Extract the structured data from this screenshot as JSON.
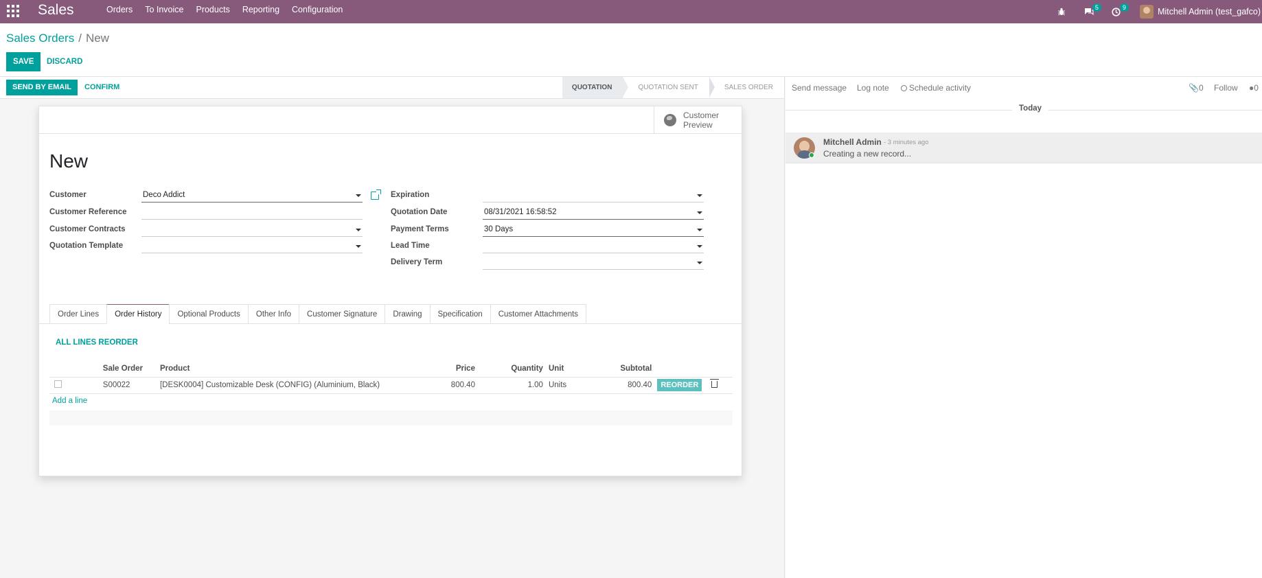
{
  "navbar": {
    "app_title": "Sales",
    "menu": [
      "Orders",
      "To Invoice",
      "Products",
      "Reporting",
      "Configuration"
    ],
    "messages_badge": "5",
    "activities_badge": "9",
    "user_name": "Mitchell Admin (test_gafco)"
  },
  "breadcrumb": {
    "parent": "Sales Orders",
    "separator": "/",
    "current": "New"
  },
  "actions": {
    "save": "SAVE",
    "discard": "DISCARD"
  },
  "statusbar": {
    "send_email": "SEND BY EMAIL",
    "confirm": "CONFIRM",
    "stages": [
      "QUOTATION",
      "QUOTATION SENT",
      "SALES ORDER"
    ],
    "active_stage": "QUOTATION"
  },
  "smart_button": {
    "label": "Customer Preview"
  },
  "form": {
    "title": "New",
    "left_fields": [
      {
        "label": "Customer",
        "value": "Deco Addict"
      },
      {
        "label": "Customer Reference",
        "value": ""
      },
      {
        "label": "Customer Contracts",
        "value": ""
      },
      {
        "label": "Quotation Template",
        "value": ""
      }
    ],
    "right_fields": [
      {
        "label": "Expiration",
        "value": ""
      },
      {
        "label": "Quotation Date",
        "value": "08/31/2021 16:58:52"
      },
      {
        "label": "Payment Terms",
        "value": "30 Days"
      },
      {
        "label": "Lead Time",
        "value": ""
      },
      {
        "label": "Delivery Term",
        "value": ""
      }
    ]
  },
  "tabs": [
    "Order Lines",
    "Order History",
    "Optional Products",
    "Other Info",
    "Customer Signature",
    "Drawing",
    "Specification",
    "Customer Attachments"
  ],
  "active_tab": "Order History",
  "history": {
    "reorder_all": "ALL LINES REORDER",
    "columns": [
      "Sale Order",
      "Product",
      "Price",
      "Quantity",
      "Unit",
      "Subtotal"
    ],
    "rows": [
      {
        "sale_order": "S00022",
        "product": "[DESK0004] Customizable Desk (CONFIG) (Aluminium, Black)",
        "price": "800.40",
        "quantity": "1.00",
        "unit": "Units",
        "subtotal": "800.40",
        "action": "REORDER"
      }
    ],
    "add_line": "Add a line"
  },
  "chatter": {
    "send_message": "Send message",
    "log_note": "Log note",
    "schedule_activity": "Schedule activity",
    "attachments_count": "0",
    "follow": "Follow",
    "followers_count": "0",
    "date_separator": "Today",
    "message": {
      "author": "Mitchell Admin",
      "time": "- 3 minutes ago",
      "body": "Creating a new record..."
    }
  },
  "colors": {
    "navbar": "#875a7b",
    "primary": "#00a09d",
    "reorder": "#5bc0be"
  }
}
